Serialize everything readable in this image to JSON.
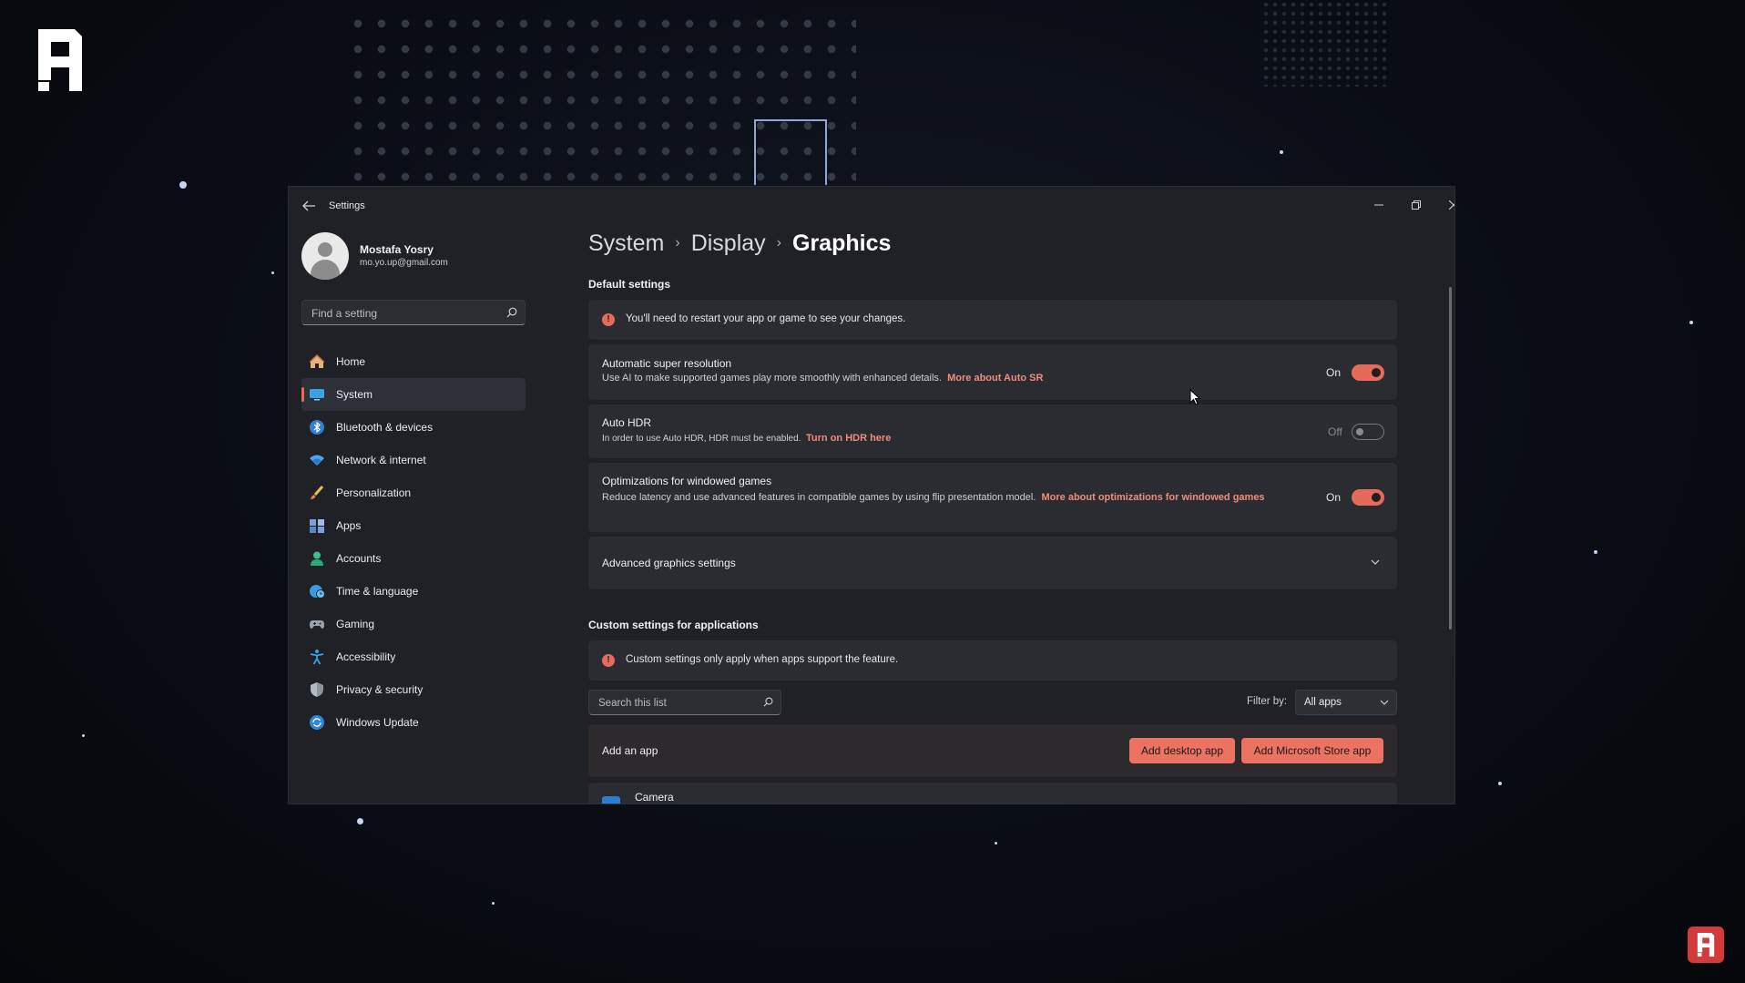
{
  "window": {
    "title": "Settings",
    "controls": [
      "minimize",
      "restore",
      "close"
    ]
  },
  "profile": {
    "name": "Mostafa Yosry",
    "email": "mo.yo.up@gmail.com"
  },
  "search": {
    "placeholder": "Find a setting"
  },
  "nav": {
    "items": [
      {
        "label": "Home",
        "icon": "home-icon"
      },
      {
        "label": "System",
        "icon": "monitor-icon",
        "active": true
      },
      {
        "label": "Bluetooth & devices",
        "icon": "bluetooth-icon"
      },
      {
        "label": "Network & internet",
        "icon": "wifi-icon"
      },
      {
        "label": "Personalization",
        "icon": "brush-icon"
      },
      {
        "label": "Apps",
        "icon": "apps-icon"
      },
      {
        "label": "Accounts",
        "icon": "person-icon"
      },
      {
        "label": "Time & language",
        "icon": "globe-clock-icon"
      },
      {
        "label": "Gaming",
        "icon": "gamepad-icon"
      },
      {
        "label": "Accessibility",
        "icon": "accessibility-icon"
      },
      {
        "label": "Privacy & security",
        "icon": "shield-icon"
      },
      {
        "label": "Windows Update",
        "icon": "update-icon"
      }
    ]
  },
  "breadcrumb": [
    "System",
    "Display",
    "Graphics"
  ],
  "default_settings": {
    "heading": "Default settings",
    "notice": "You'll need to restart your app or game to see your changes.",
    "auto_sr": {
      "title": "Automatic super resolution",
      "desc": "Use AI to make supported games play more smoothly with enhanced details.",
      "link": "More about Auto SR",
      "state": "On"
    },
    "auto_hdr": {
      "title": "Auto HDR",
      "desc": "In order to use Auto HDR, HDR must be enabled.",
      "link": "Turn on HDR here",
      "state": "Off"
    },
    "windowed": {
      "title": "Optimizations for windowed games",
      "desc": "Reduce latency and use advanced features in compatible games by using flip presentation model.",
      "link": "More about optimizations for windowed games",
      "state": "On"
    },
    "advanced": {
      "title": "Advanced graphics settings"
    }
  },
  "custom_settings": {
    "heading": "Custom settings for applications",
    "notice": "Custom settings only apply when apps support the feature.",
    "search_placeholder": "Search this list",
    "filter_label": "Filter by:",
    "filter_value": "All apps",
    "add_app_label": "Add an app",
    "add_desktop_button": "Add desktop app",
    "add_store_button": "Add Microsoft Store app",
    "apps": [
      {
        "name": "Camera",
        "icon": "camera-icon"
      }
    ]
  },
  "colors": {
    "accent": "#e56a5a",
    "link": "#f08c7c",
    "window_bg": "#1f2126",
    "card_bg": "#2a2c31",
    "brand_red": "#d33a3a"
  }
}
